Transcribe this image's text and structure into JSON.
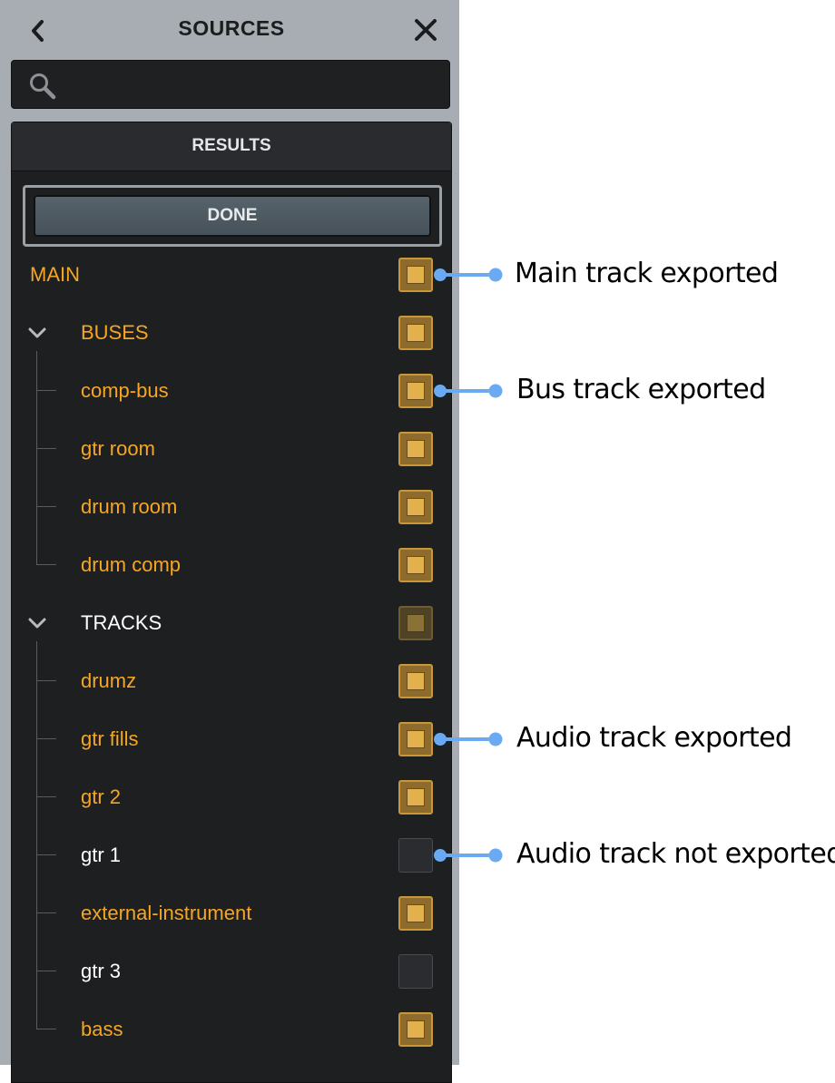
{
  "header": {
    "title": "SOURCES",
    "back_icon": "chevron-left-icon",
    "close_icon": "close-icon"
  },
  "search": {
    "value": "",
    "placeholder": "",
    "icon": "search-icon"
  },
  "results_label": "RESULTS",
  "done_label": "DONE",
  "colors": {
    "exported_label": "#f6a623",
    "unexported_label": "#ffffff",
    "checkbox_fill": "#e3b04e",
    "connector": "#6aaaf2",
    "panel_bg": "#1e1f21"
  },
  "rows": [
    {
      "label": "MAIN",
      "kind": "main",
      "checked": "on",
      "exported": true
    },
    {
      "label": "BUSES",
      "kind": "group",
      "checked": "on",
      "exported": true,
      "expanded": true
    },
    {
      "label": "comp-bus",
      "kind": "child",
      "checked": "on",
      "exported": true
    },
    {
      "label": "gtr room",
      "kind": "child",
      "checked": "on",
      "exported": true
    },
    {
      "label": "drum room",
      "kind": "child",
      "checked": "on",
      "exported": true
    },
    {
      "label": "drum comp",
      "kind": "child",
      "checked": "on",
      "exported": true
    },
    {
      "label": "TRACKS",
      "kind": "group",
      "checked": "mixed",
      "exported": false,
      "expanded": true
    },
    {
      "label": "drumz",
      "kind": "child",
      "checked": "on",
      "exported": true
    },
    {
      "label": "gtr fills",
      "kind": "child",
      "checked": "on",
      "exported": true
    },
    {
      "label": "gtr 2",
      "kind": "child",
      "checked": "on",
      "exported": true
    },
    {
      "label": "gtr 1",
      "kind": "child",
      "checked": "off",
      "exported": false
    },
    {
      "label": "external-instrument",
      "kind": "child",
      "checked": "on",
      "exported": true
    },
    {
      "label": "gtr 3",
      "kind": "child",
      "checked": "off",
      "exported": false
    },
    {
      "label": "bass",
      "kind": "child",
      "checked": "on",
      "exported": true
    }
  ],
  "annotations": [
    {
      "text": "Main track exported",
      "row": 0
    },
    {
      "text": "Bus track exported",
      "row": 2
    },
    {
      "text": "Audio track exported",
      "row": 8
    },
    {
      "text": "Audio track not exported",
      "row": 10
    }
  ]
}
